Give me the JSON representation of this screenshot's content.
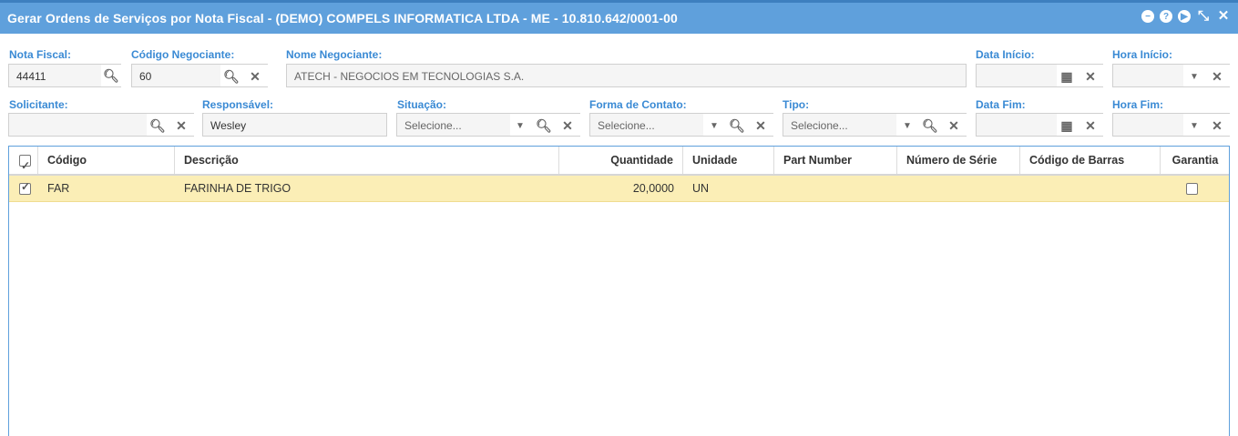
{
  "window": {
    "title": "Gerar Ordens de Serviços por Nota Fiscal - (DEMO) COMPELS INFORMATICA LTDA - ME - 10.810.642/0001-00",
    "controls": [
      "minimize-icon",
      "help-icon",
      "next-icon",
      "collapse-icon",
      "close-icon"
    ]
  },
  "form": {
    "nota_fiscal": {
      "label": "Nota Fiscal:",
      "value": "44411"
    },
    "codigo_negociante": {
      "label": "Código Negociante:",
      "value": "60"
    },
    "nome_negociante": {
      "label": "Nome Negociante:",
      "value": "ATECH - NEGOCIOS EM TECNOLOGIAS S.A."
    },
    "data_inicio": {
      "label": "Data Início:",
      "value": ""
    },
    "hora_inicio": {
      "label": "Hora Início:",
      "value": ""
    },
    "solicitante": {
      "label": "Solicitante:",
      "value": ""
    },
    "responsavel": {
      "label": "Responsável:",
      "value": "Wesley"
    },
    "situacao": {
      "label": "Situação:",
      "value": "Selecione..."
    },
    "forma_contato": {
      "label": "Forma de Contato:",
      "value": "Selecione..."
    },
    "tipo": {
      "label": "Tipo:",
      "value": "Selecione..."
    },
    "data_fim": {
      "label": "Data Fim:",
      "value": ""
    },
    "hora_fim": {
      "label": "Hora Fim:",
      "value": ""
    }
  },
  "grid": {
    "headers": {
      "codigo": "Código",
      "descricao": "Descrição",
      "quantidade": "Quantidade",
      "unidade": "Unidade",
      "part_number": "Part Number",
      "numero_serie": "Número de Série",
      "codigo_barras": "Código de Barras",
      "garantia": "Garantia"
    },
    "rows": [
      {
        "selected": true,
        "codigo": "FAR",
        "descricao": "FARINHA DE TRIGO",
        "quantidade": "20,0000",
        "unidade": "UN",
        "part_number": "",
        "numero_serie": "",
        "codigo_barras": "",
        "garantia": false
      }
    ]
  },
  "colors": {
    "accent": "#5fa0dc",
    "label": "#3a8ad4",
    "selected_row": "#fbeeb6"
  }
}
